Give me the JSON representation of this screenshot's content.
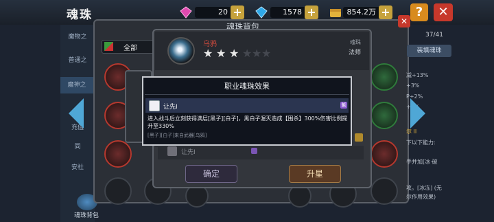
{
  "header": {
    "title": "魂珠",
    "currencies": [
      {
        "icon": "pink-gem-icon",
        "value": "20",
        "color": "#e04ab0"
      },
      {
        "icon": "blue-gem-icon",
        "value": "1578",
        "color": "#2fa8e8"
      },
      {
        "icon": "gold-chest-icon",
        "value": "854.2万",
        "color": "#e2b23b"
      }
    ],
    "help_label": "?",
    "close_label": "✕"
  },
  "sidebar": {
    "items": [
      {
        "label": "魔物之"
      },
      {
        "label": "普通之"
      },
      {
        "label": "魔神之"
      },
      {
        "label": "充值"
      },
      {
        "label": "同"
      },
      {
        "label": "安社"
      }
    ],
    "bag_label": "魂珠背包"
  },
  "bag_panel": {
    "title": "魂珠背包",
    "filter_label": "全部",
    "count": "37/41",
    "equip_button": "装填魂珠",
    "stats": [
      "减+13%",
      "+3%",
      "P+2%",
      "+2%",
      "尔 II",
      "下以下能力:",
      "手并加[冰·破",
      "攻。[冰冻] (无",
      "尔作用效果)"
    ]
  },
  "detail_panel": {
    "orb_name": "乌鸦",
    "stars_filled": 3,
    "stars_total": 6,
    "type_label": "魂珠",
    "class_label": "法师",
    "faded_skill": "让先Ⅰ",
    "confirm_label": "确定",
    "upgrade_label": "升星"
  },
  "dialog": {
    "title": "职业魂珠效果",
    "skill_name": "让先Ⅰ",
    "badge": "紫",
    "description": "进入战斗后立刻获得满层[黑子][白子]，黑白子渥灭造成【围杀】300%伤害比例提升至330%",
    "source": "[黑子][白子]来自武器[乌鸦]"
  }
}
